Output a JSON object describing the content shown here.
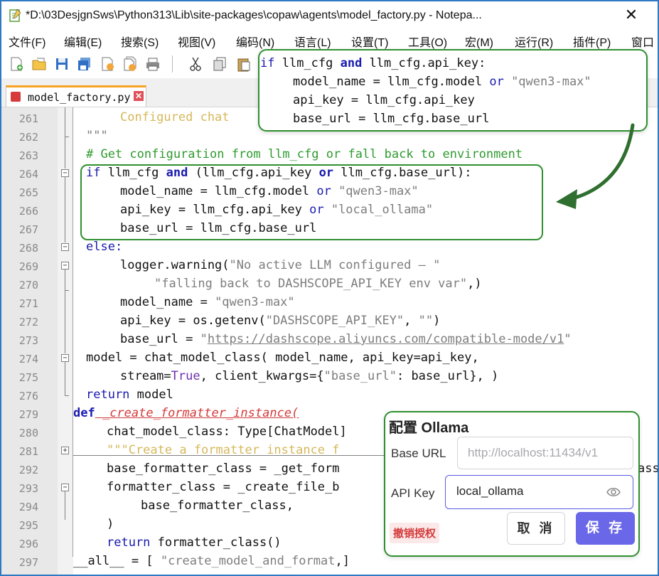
{
  "window": {
    "title": "*D:\\03DesjgnSws\\Python313\\Lib\\site-packages\\copaw\\agents\\model_factory.py - Notepa...",
    "minimize_glyph": "✕"
  },
  "menu": [
    "文件(F)",
    "编辑(E)",
    "搜索(S)",
    "视图(V)",
    "编码(N)",
    "语言(L)",
    "设置(T)",
    "工具(O)",
    "宏(M)",
    "运行(R)",
    "插件(P)",
    "窗口"
  ],
  "tab": {
    "label": "model_factory.py",
    "close": "✕"
  },
  "colors": {
    "accent_green": "#2f8f2f",
    "keyword": "#1a1ab0",
    "comment": "#2e9b2e",
    "string": "#7d7d7d",
    "save_button": "#6a67e8",
    "revoke": "#d43b3b"
  },
  "gutter": {
    "line_numbers": [
      "261",
      "262",
      "263",
      "264",
      "265",
      "266",
      "267",
      "268",
      "269",
      "270",
      "271",
      "272",
      "273",
      "274",
      "275",
      "276",
      "279",
      "280",
      "281",
      "292",
      "293",
      "294",
      "295",
      "296",
      "297"
    ]
  },
  "code": {
    "l261": "Configured chat",
    "l262": "\"\"\"",
    "l263": "# Get configuration from llm_cfg or fall back to environment",
    "l264_a": "if",
    "l264_b": " llm_cfg ",
    "l264_c": "and",
    "l264_d": " (llm_cfg.api_key ",
    "l264_e": "or",
    "l264_f": " llm_cfg.base_url):",
    "l265_a": "model_name = llm_cfg.model ",
    "l265_b": "or",
    "l265_c": " \"qwen3-max\"",
    "l266_a": "api_key = llm_cfg.api_key ",
    "l266_b": "or",
    "l266_c": " \"local_ollama\"",
    "l267": "base_url = llm_cfg.base_url",
    "l268": "else:",
    "l269_a": "logger.warning(",
    "l269_b": "\"No active LLM configured — \"",
    "l270_a": "\"falling back to DASHSCOPE_API_KEY env var\"",
    "l270_b": ",)",
    "l271_a": "model_name = ",
    "l271_b": "\"qwen3-max\"",
    "l272_a": "api_key = os.getenv(",
    "l272_b": "\"DASHSCOPE_API_KEY\"",
    "l272_c": ", ",
    "l272_d": "\"\"",
    "l272_e": ")",
    "l273_a": "base_url = ",
    "l273_b": "\"",
    "l273_c": "https://dashscope.aliyuncs.com/compatible-mode/v1",
    "l273_d": "\"",
    "l274": "model = chat_model_class( model_name, api_key=api_key,",
    "l275_a": "stream=",
    "l275_b": "True",
    "l275_c": ", client_kwargs={",
    "l275_d": "\"base_url\"",
    "l275_e": ": base_url}, )",
    "l276_a": "return",
    "l276_b": " model",
    "l279_a": "def",
    "l279_b": " _create_formatter_instance(",
    "l280": "chat_model_class: Type[ChatModel]",
    "l281": "\"\"\"Create a formatter instance f",
    "l292": "base_formatter_class = _get_form",
    "l292_tail": "ass",
    "l293": "formatter_class = _create_file_b",
    "l294": "base_formatter_class,",
    "l295": ")",
    "l296_a": "return",
    "l296_b": " formatter_class()",
    "l297_a": "__all__ = [ ",
    "l297_b": "\"create_model_and_format",
    "l297_c": ",]"
  },
  "popup": {
    "p1_a": "if",
    "p1_b": " llm_cfg ",
    "p1_c": "and",
    "p1_d": " llm_cfg.api_key:",
    "p2_a": "model_name = llm_cfg.model ",
    "p2_b": "or",
    "p2_c": " \"qwen3-max\"",
    "p3": "api_key = llm_cfg.api_key",
    "p4": "base_url = llm_cfg.base_url"
  },
  "settings_card": {
    "title": "配置 Ollama",
    "base_url_label": "Base URL",
    "base_url_placeholder": "http://localhost:11434/v1",
    "api_key_label": "API Key",
    "api_key_value": "local_ollama",
    "revoke_label": "撤销授权",
    "cancel_label": "取 消",
    "save_label": "保 存"
  }
}
